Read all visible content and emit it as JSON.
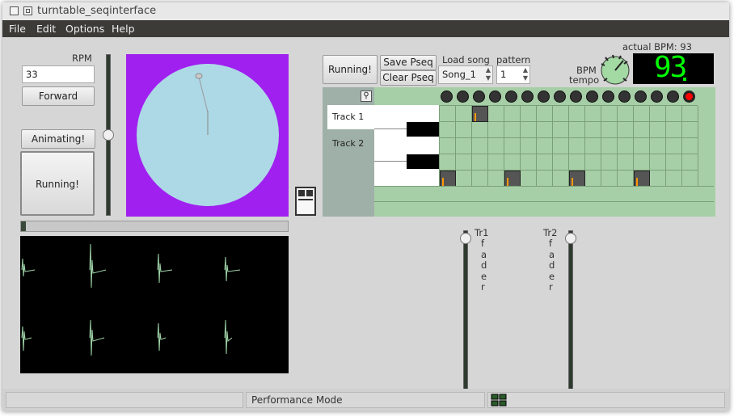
{
  "window": {
    "title": "turntable_seqinterface"
  },
  "menu": {
    "items": [
      "File",
      "Edit",
      "Options",
      "Help"
    ]
  },
  "left": {
    "rpm_label": "RPM",
    "rpm_value": "33",
    "forward_label": "Forward",
    "animating_label": "Animating!",
    "running_label": "Running!"
  },
  "sequencer": {
    "running_label": "Running!",
    "save_label": "Save Pseq",
    "clear_label": "Clear Pseq",
    "load_song_label": "Load song",
    "song_value": "Song_1",
    "pattern_label": "pattern",
    "pattern_value": "1",
    "actual_bpm_label": "actual BPM: 93",
    "bpm_label": "BPM",
    "tempo_label": "tempo",
    "bpm_display": "93",
    "tracks": [
      {
        "label": "Track 1"
      },
      {
        "label": "Track 2"
      }
    ],
    "active_led_step": 15
  },
  "faders": {
    "tr1": {
      "label": "Tr1",
      "sub": [
        "f",
        "a",
        "d",
        "e",
        "r"
      ]
    },
    "tr2": {
      "label": "Tr2",
      "sub": [
        "f",
        "a",
        "d",
        "e",
        "r"
      ]
    }
  },
  "status": {
    "mode": "Performance Mode"
  },
  "colors": {
    "turntable_bg": "#a020f0",
    "platter": "#add8e6",
    "seq_grid": "#a7cfa7",
    "led_active": "#ff0000",
    "lcd_digits": "#00ff00",
    "note_marker": "#ff9900"
  },
  "icons": {
    "pin": "pin-icon",
    "tempo_knob": "knob-icon",
    "network": "network-icon"
  }
}
